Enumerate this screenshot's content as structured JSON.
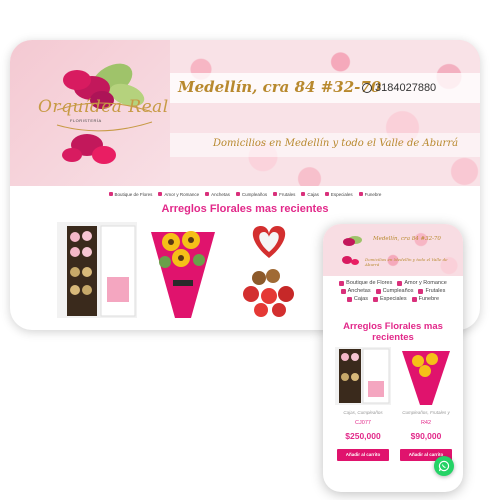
{
  "desktop": {
    "logo": {
      "name": "Orquídea Real",
      "subtitle": "FLORISTERÍA"
    },
    "banner": {
      "address": "Medellín, cra 84 #32-70",
      "phone": "3184027880",
      "delivery": "Domicilios en Medellín y todo el Valle de Aburrá"
    },
    "nav": [
      {
        "label": "Boutique de Flores",
        "icon": "boutique-icon"
      },
      {
        "label": "Amor y Romance",
        "icon": "heart-icon"
      },
      {
        "label": "Anchetas",
        "icon": "gift-icon"
      },
      {
        "label": "Cumpleaños",
        "icon": "cake-icon"
      },
      {
        "label": "Frutales",
        "icon": "fruit-icon"
      },
      {
        "label": "Cajas",
        "icon": "box-icon"
      },
      {
        "label": "Especiales",
        "icon": "star-icon"
      },
      {
        "label": "Funebre",
        "icon": "wreath-icon"
      }
    ],
    "section_title": "Arreglos Florales mas recientes"
  },
  "mobile": {
    "banner": {
      "address": "Medellín, cra 84 #32-70",
      "delivery": "Domicilios en Medellín y todo el Valle de Aburrá"
    },
    "nav": [
      {
        "label": "Boutique de Flores"
      },
      {
        "label": "Amor y Romance"
      },
      {
        "label": "Anchetas"
      },
      {
        "label": "Cumpleaños"
      },
      {
        "label": "Frutales"
      },
      {
        "label": "Cajas"
      },
      {
        "label": "Especiales"
      },
      {
        "label": "Funebre"
      }
    ],
    "section_title": "Arreglos Florales mas recientes",
    "products": [
      {
        "category": "Cajas, Cumpleaños",
        "sku": "CJ077",
        "price": "$250,000",
        "button": "Añadir al carrito"
      },
      {
        "category": "Cumpleaños, Frutales y",
        "sku": "R42",
        "price": "$90,000",
        "button": "Añadir al carrito"
      }
    ]
  },
  "colors": {
    "accent": "#e2298a",
    "button": "#e0136d",
    "gold": "#b8892e",
    "whatsapp": "#25d366"
  }
}
